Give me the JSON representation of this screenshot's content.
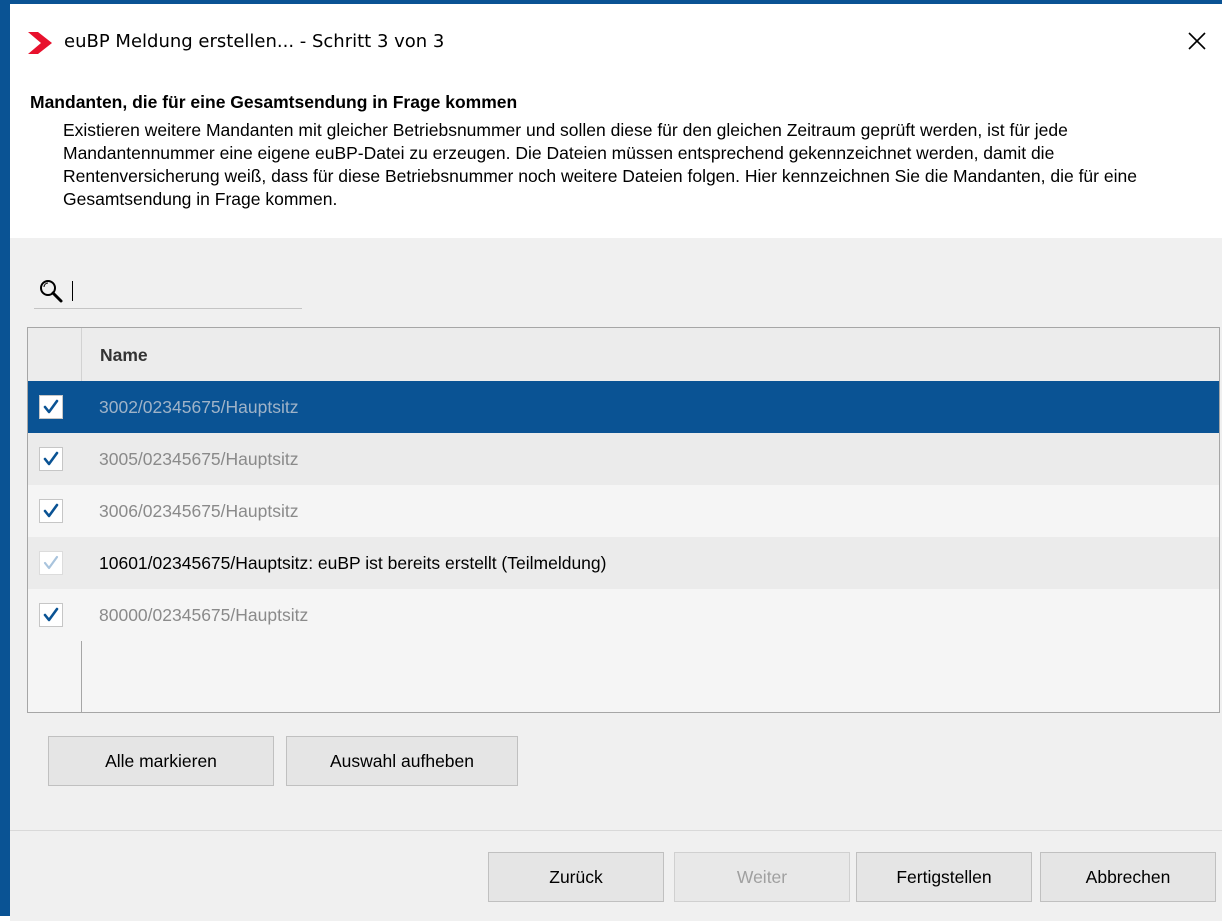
{
  "window": {
    "title": "euBP Meldung erstellen... - Schritt 3 von 3",
    "accent_color": "#0a5394",
    "app_icon": "red-chevron-icon",
    "close_icon": "close-icon"
  },
  "header": {
    "section_title": "Mandanten, die für eine Gesamtsendung in Frage kommen",
    "description": "Existieren weitere Mandanten mit gleicher Betriebsnummer und sollen diese für den gleichen Zeitraum geprüft werden, ist für jede Mandantennummer eine eigene euBP-Datei zu erzeugen. Die Dateien müssen entsprechend gekennzeichnet werden, damit die Rentenversicherung weiß, dass für diese Betriebsnummer noch weitere Dateien folgen. Hier kennzeichnen Sie die Mandanten, die für eine Gesamtsendung in Frage kommen."
  },
  "search": {
    "icon": "search-icon",
    "value": "",
    "placeholder": ""
  },
  "table": {
    "columns": [
      "",
      "Name"
    ],
    "rows": [
      {
        "checked": true,
        "enabled": true,
        "selected": true,
        "name": "3002/02345675/Hauptsitz"
      },
      {
        "checked": true,
        "enabled": true,
        "selected": false,
        "name": "3005/02345675/Hauptsitz"
      },
      {
        "checked": true,
        "enabled": true,
        "selected": false,
        "name": "3006/02345675/Hauptsitz"
      },
      {
        "checked": true,
        "enabled": false,
        "selected": false,
        "name": "10601/02345675/Hauptsitz: euBP ist bereits erstellt (Teilmeldung)"
      },
      {
        "checked": true,
        "enabled": true,
        "selected": false,
        "name": "80000/02345675/Hauptsitz"
      }
    ]
  },
  "selection_buttons": {
    "select_all": "Alle markieren",
    "clear_selection": "Auswahl aufheben"
  },
  "footer": {
    "back": "Zurück",
    "next": "Weiter",
    "finish": "Fertigstellen",
    "cancel": "Abbrechen"
  }
}
